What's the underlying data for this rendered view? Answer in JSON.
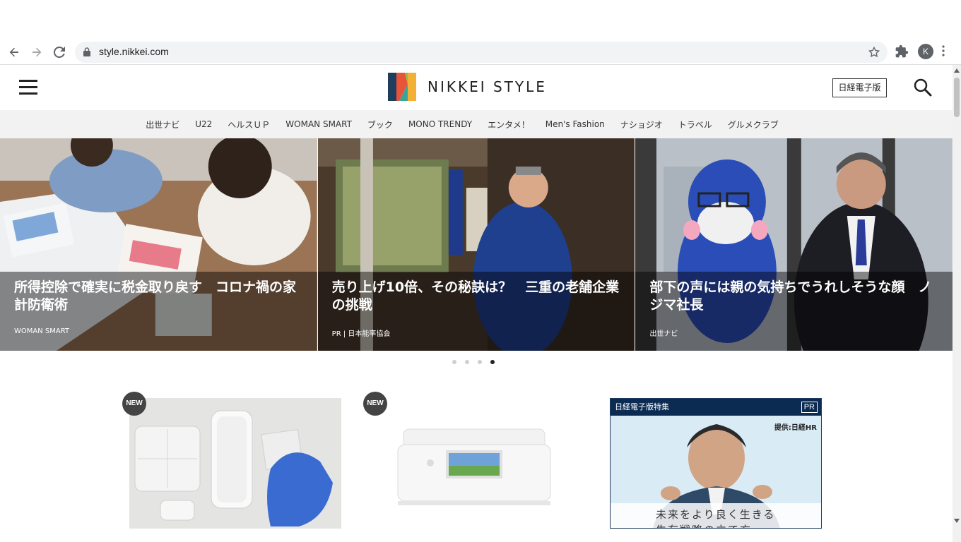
{
  "browser": {
    "url": "style.nikkei.com",
    "profile_initial": "K"
  },
  "header": {
    "logo_text": "NIKKEI STYLE",
    "nikkei_button": "日経電子版"
  },
  "categories": [
    "出世ナビ",
    "U22",
    "ヘルスＵＰ",
    "WOMAN SMART",
    "ブック",
    "MONO TRENDY",
    "エンタメ！",
    "Men's Fashion",
    "ナショジオ",
    "トラベル",
    "グルメクラブ"
  ],
  "slides": [
    {
      "title": "所得控除で確実に税金取り戻す　コロナ禍の家計防衛術",
      "tag": "WOMAN SMART"
    },
    {
      "title": "売り上げ10倍、その秘訣は？　三重の老舗企業の挑戦",
      "tag": "PR | 日本能率協会"
    },
    {
      "title": "部下の声には親の気持ちでうれしそうな顔　ノジマ社長",
      "tag": "出世ナビ"
    }
  ],
  "carousel": {
    "total": 4,
    "active_index": 3
  },
  "cards": [
    {
      "badge": "NEW"
    },
    {
      "badge": "NEW"
    }
  ],
  "ad": {
    "header": "日経電子版特集",
    "pr_label": "PR",
    "sponsor": "提供:日経HR",
    "copy_line1": "未来をより良く生きる",
    "copy_line2": "生存戦略の立て方"
  },
  "colors": {
    "ad_header": "#0b2b52",
    "badge": "#444444",
    "catnav_bg": "#f2f2f2"
  }
}
